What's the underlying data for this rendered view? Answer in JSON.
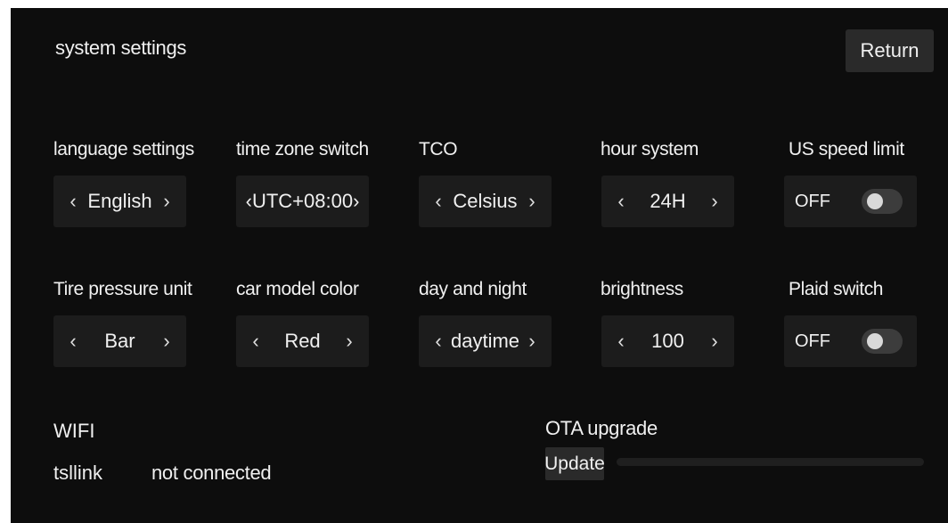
{
  "header": {
    "title": "system settings",
    "return_label": "Return"
  },
  "settings": {
    "language": {
      "label": "language settings",
      "value": "English"
    },
    "timezone": {
      "label": "time zone switch",
      "value": "UTC+08:00"
    },
    "tco": {
      "label": "TCO",
      "value": "Celsius"
    },
    "hour_system": {
      "label": "hour system",
      "value": "24H"
    },
    "us_speed_limit": {
      "label": "US speed limit",
      "state": "OFF",
      "enabled": false
    },
    "tire_pressure": {
      "label": "Tire pressure unit",
      "value": "Bar"
    },
    "car_color": {
      "label": "car model color",
      "value": "Red"
    },
    "day_night": {
      "label": "day and night",
      "value": "daytime"
    },
    "brightness": {
      "label": "brightness",
      "value": "100"
    },
    "plaid": {
      "label": "Plaid switch",
      "state": "OFF",
      "enabled": false
    }
  },
  "arrows": {
    "prev": "‹",
    "next": "›"
  },
  "wifi": {
    "label": "WIFI",
    "ssid": "tsllink",
    "status": "not connected"
  },
  "ota": {
    "label": "OTA upgrade",
    "button": "Update",
    "progress": 0
  },
  "colors": {
    "background": "#0d0d0d",
    "control": "#1c1c1c",
    "button": "#2a2a2a",
    "text": "#f0f0f0",
    "toggle_off": "#3c3c3c"
  },
  "icons": {
    "prev": "chevron-left-icon",
    "next": "chevron-right-icon"
  }
}
